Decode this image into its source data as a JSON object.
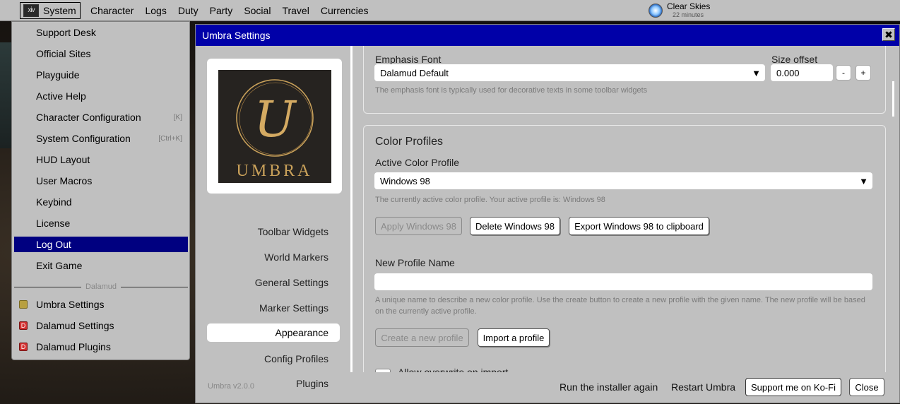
{
  "topbar": {
    "system_logo": "xiv",
    "system_label": "System",
    "menus": [
      "Character",
      "Logs",
      "Duty",
      "Party",
      "Social",
      "Travel",
      "Currencies"
    ],
    "weather": {
      "name": "Clear Skies",
      "time": "22 minutes",
      "icon": "sun-icon"
    }
  },
  "system_menu": {
    "items": [
      {
        "label": "Support Desk",
        "shortcut": ""
      },
      {
        "label": "Official Sites",
        "shortcut": ""
      },
      {
        "label": "Playguide",
        "shortcut": ""
      },
      {
        "label": "Active Help",
        "shortcut": ""
      },
      {
        "label": "Character Configuration",
        "shortcut": "[K]"
      },
      {
        "label": "System Configuration",
        "shortcut": "[Ctrl+K]"
      },
      {
        "label": "HUD Layout",
        "shortcut": ""
      },
      {
        "label": "User Macros",
        "shortcut": ""
      },
      {
        "label": "Keybind",
        "shortcut": ""
      },
      {
        "label": "License",
        "shortcut": ""
      },
      {
        "label": "Log Out",
        "shortcut": ""
      },
      {
        "label": "Exit Game",
        "shortcut": ""
      }
    ],
    "selected_index": 10,
    "separator_label": "Dalamud",
    "plugins": [
      {
        "label": "Umbra Settings",
        "icon": "umbra-icon",
        "color": "#b8a040",
        "letter": ""
      },
      {
        "label": "Dalamud Settings",
        "icon": "dalamud-icon",
        "color": "#d23030",
        "letter": "D"
      },
      {
        "label": "Dalamud Plugins",
        "icon": "dalamud-icon",
        "color": "#d23030",
        "letter": "D"
      }
    ]
  },
  "window": {
    "title": "Umbra Settings",
    "close_glyph": "✖",
    "logo_letter": "U",
    "logo_text": "UMBRA",
    "nav": [
      "Toolbar Widgets",
      "World Markers",
      "General Settings",
      "Marker Settings",
      "Appearance",
      "Config Profiles",
      "Plugins"
    ],
    "active_nav_index": 4,
    "emphasis": {
      "label": "Emphasis Font",
      "value": "Dalamud Default",
      "size_label": "Size offset",
      "size_value": "0.000",
      "minus": "-",
      "plus": "+",
      "hint": "The emphasis font is typically used for decorative texts in some toolbar widgets"
    },
    "color_profiles": {
      "heading": "Color Profiles",
      "active_label": "Active Color Profile",
      "active_value": "Windows 98",
      "active_hint": "The currently active color profile. Your active profile is: Windows 98",
      "apply_button": "Apply Windows 98",
      "delete_button": "Delete Windows 98",
      "export_button": "Export Windows 98 to clipboard",
      "new_name_label": "New Profile Name",
      "new_name_value": "",
      "new_name_hint": "A unique name to describe a new color profile. Use the create button to create a new profile with the given name. The new profile will be based on the currently active profile.",
      "create_button": "Create a new profile",
      "import_button": "Import a profile",
      "overwrite_label": "Allow overwrite on import"
    },
    "footer": {
      "version": "Umbra v2.0.0",
      "run_installer": "Run the installer again",
      "restart": "Restart Umbra",
      "kofi": "Support me on Ko-Fi",
      "close": "Close"
    },
    "colors": {
      "title_bar": "#0000a8",
      "selected_menu": "#000080",
      "chrome": "#c0c0c0",
      "logo_gold": "#c9a15a"
    }
  }
}
